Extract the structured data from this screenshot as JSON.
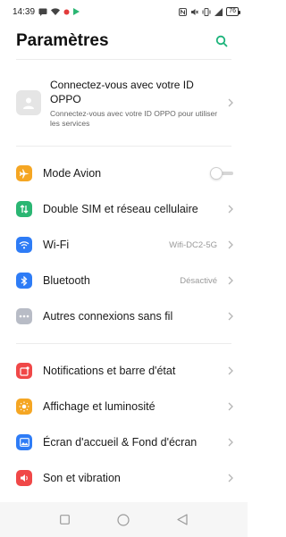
{
  "status_bar": {
    "time": "14:39",
    "battery": "76"
  },
  "header": {
    "title": "Paramètres"
  },
  "account": {
    "title": "Connectez-vous avec votre ID OPPO",
    "subtitle": "Connectez-vous avec votre ID OPPO pour utiliser les services"
  },
  "connectivity": {
    "airplane": {
      "label": "Mode Avion",
      "enabled": false
    },
    "sim": {
      "label": "Double SIM et réseau cellulaire"
    },
    "wifi": {
      "label": "Wi-Fi",
      "value": "Wifi-DC2-5G"
    },
    "bluetooth": {
      "label": "Bluetooth",
      "value": "Désactivé"
    },
    "other": {
      "label": "Autres connexions sans fil"
    }
  },
  "device": {
    "notifications": {
      "label": "Notifications et barre d'état"
    },
    "display": {
      "label": "Affichage et luminosité"
    },
    "home": {
      "label": "Écran d'accueil & Fond d'écran"
    },
    "sound": {
      "label": "Son et vibration"
    }
  },
  "colors": {
    "accent": "#1bb37a",
    "airplane": "#f5a623",
    "sim": "#2bb673",
    "wifi": "#2e7cf6",
    "bluetooth": "#2e7cf6",
    "other": "#b8bcc6",
    "notifications": "#f04848",
    "display": "#f5a623",
    "home": "#2e7cf6",
    "sound": "#f04848"
  }
}
